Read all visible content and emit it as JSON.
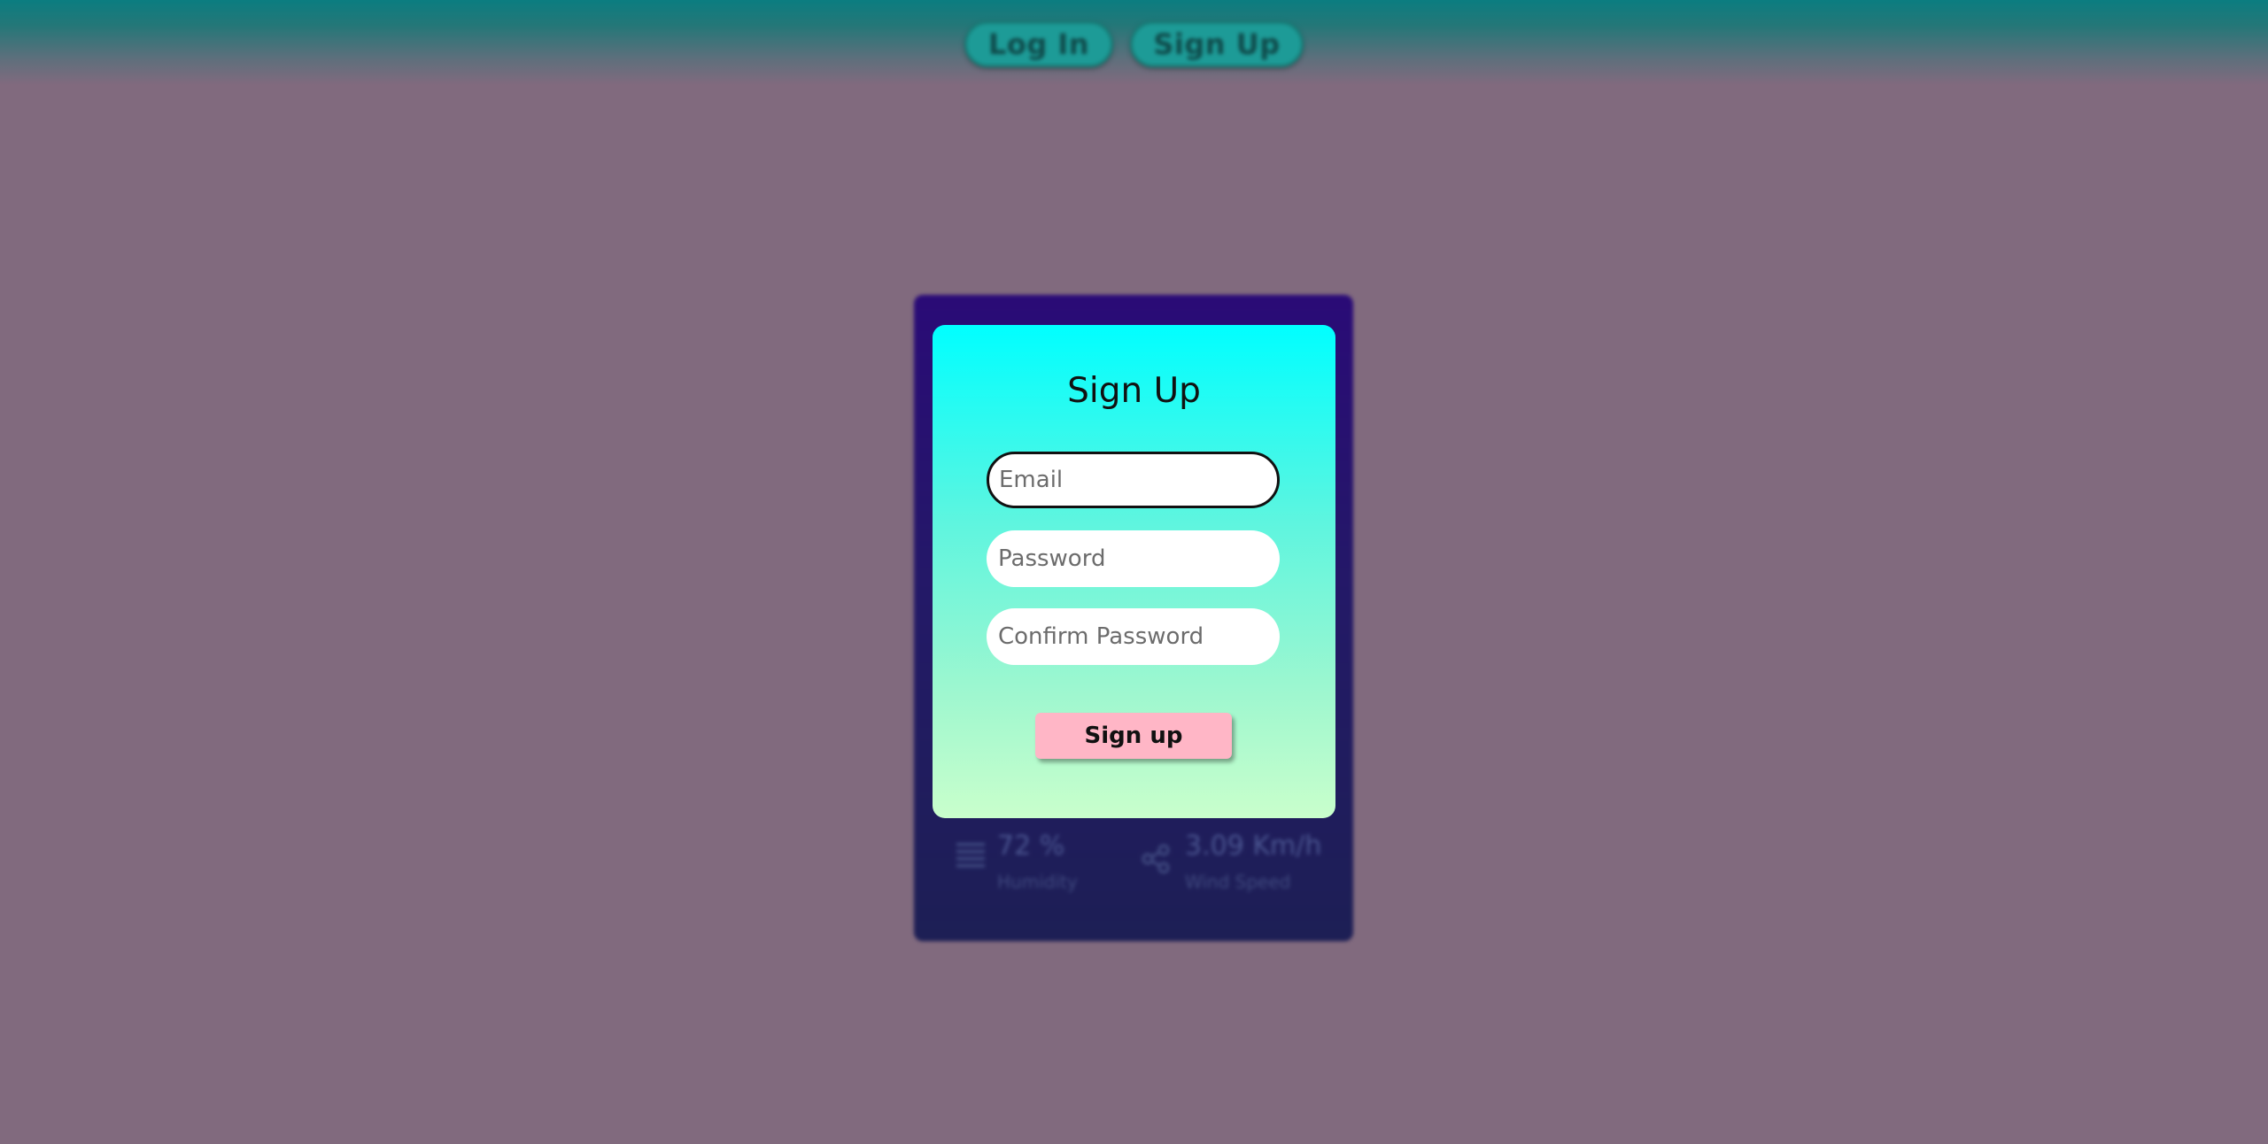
{
  "nav": {
    "login_label": "Log In",
    "signup_label": "Sign Up"
  },
  "weather": {
    "humidity_value": "72 %",
    "humidity_label": "Humidity",
    "humidity_icon": "humidity-lines-icon",
    "wind_value": "3.09 Km/h",
    "wind_label": "Wind Speed",
    "wind_icon": "wind-icon"
  },
  "signup": {
    "title": "Sign Up",
    "email_placeholder": "Email",
    "email_value": "",
    "password_placeholder": "Password",
    "password_value": "",
    "confirm_placeholder": "Confirm Password",
    "confirm_value": "",
    "submit_label": "Sign up"
  },
  "colors": {
    "page_background": "#816a7e",
    "topbar": "#0b7d80",
    "card_gradient_top": "#00ffff",
    "card_gradient_bottom": "#c9ffcc",
    "submit_button": "#ffb6c6",
    "weather_card": "#2a0b77"
  }
}
